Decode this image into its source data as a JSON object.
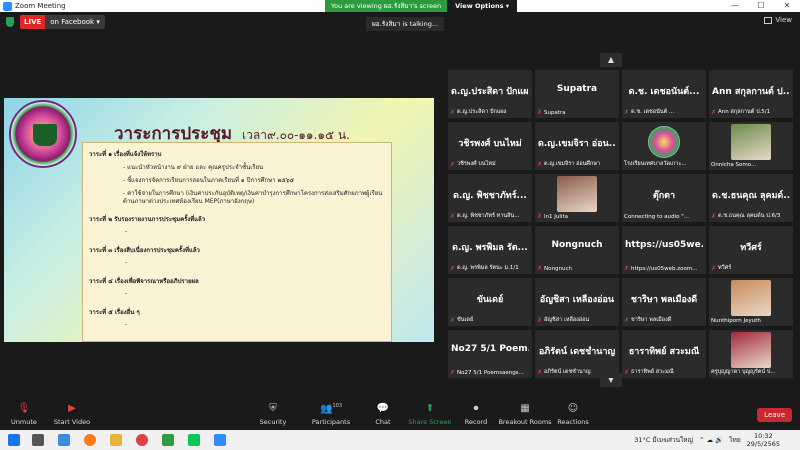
{
  "window": {
    "title": "Zoom Meeting",
    "minimize": "—",
    "maximize": "☐",
    "close": "✕"
  },
  "banner": {
    "viewing": "You are viewing ผอ.รังสิมา's screen",
    "view_options": "View Options ▾"
  },
  "topbar": {
    "live_tag": "LIVE",
    "live_target": "on Facebook ▾",
    "view_label": "View"
  },
  "talking": "ผอ.รังสิมา is talking...",
  "pager": {
    "up": "▲",
    "down": "▼"
  },
  "slide": {
    "headline": "วาระการประชุม",
    "time": "เวลา๙.๐๐-๑๑.๑๕ น.",
    "agenda": [
      {
        "title": "วาระที่ ๑ เรื่องที่แจ้งให้ทราบ",
        "items": [
          "- แนะนำหัวหน้างาน ๙ ฝ่าย และ คุณครูประจำชั้นเรียน",
          "- ชี้แจงการจัดการเรียนการสอนในภาคเรียนที่ ๑ ปีการศึกษา ๒๕๖๕",
          "- ค่าใช้จ่ายในการศึกษา (เงินค่าประกันอุบัติเหตุ/เงินค่าบำรุงการศึกษาโครงการส่งเสริมศักยภาพผู้เรียน ด้านภาษาต่างประเทศห้องเรียน MEP(ภาษาอังกฤษ)"
        ]
      },
      {
        "title": "วาระที่ ๒ รับรองรายงานการประชุมครั้งที่แล้ว",
        "items": [
          "-"
        ]
      },
      {
        "title": "วาระที่ ๓ เรื่องสืบเนื่องการประชุมครั้งที่แล้ว",
        "items": [
          "-"
        ]
      },
      {
        "title": "วาระที่ ๔ เรื่องเพื่อพิจารณาหรืออภิปรายผล",
        "items": [
          "-"
        ]
      },
      {
        "title": "วาระที่ ๕ เรื่องอื่น ๆ",
        "items": [
          "-"
        ]
      }
    ]
  },
  "participants": [
    {
      "big": "ด.ญ.ประสิดา ปักแผ...",
      "foot": "ด.ญ.ประสิดา ปักแผง",
      "muted": true,
      "photo": ""
    },
    {
      "big": "Supatra",
      "foot": "Supatra",
      "muted": true,
      "photo": ""
    },
    {
      "big": "ด.ช. เดชอนันต์...",
      "foot": "ด.ช. เดชอนันต์ ...",
      "muted": true,
      "photo": ""
    },
    {
      "big": "Ann สกุลกานต์ ป...",
      "foot": "Ann สกุลกานต์ ป.5/1",
      "muted": true,
      "photo": ""
    },
    {
      "big": "วชิรพงศ์ บนไหม่",
      "foot": "วชิรพงศ์ บนไหม่",
      "muted": true,
      "photo": ""
    },
    {
      "big": "ด.ญ.เขมจิรา อ่อน...",
      "foot": "ด.ญ.เขมจิรา อ่อนศึกษา",
      "muted": true,
      "photo": ""
    },
    {
      "big": "",
      "foot": "โรงเรียนเทศบาลวัดเกาะ...",
      "muted": false,
      "photo": "logo"
    },
    {
      "big": "",
      "foot": "Onnicha Somo...",
      "muted": false,
      "photo": "#6d8a4a"
    },
    {
      "big": "ด.ญ. พิชชาภัทร์...",
      "foot": "ด.ญ. พิชชาภัทร์ ทานสิน...",
      "muted": true,
      "photo": ""
    },
    {
      "big": "",
      "foot": "ln1 Julita",
      "muted": true,
      "photo": "#8a5a4a"
    },
    {
      "big": "ตุ๊กตา",
      "foot": "Connecting to audio \"...",
      "muted": false,
      "photo": ""
    },
    {
      "big": "ด.ช.ธนคุณ ลุคมด์...",
      "foot": "ด.ช.ธนคุณ ลุคมด์น ป.6/3",
      "muted": true,
      "photo": ""
    },
    {
      "big": "ด.ญ. พรพิมล รัต...",
      "foot": "ด.ญ. พรพิมล รัตนะ ม.1/1",
      "muted": true,
      "photo": ""
    },
    {
      "big": "Nongnuch",
      "foot": "Nongnuch",
      "muted": true,
      "photo": ""
    },
    {
      "big": "https://us05we...",
      "foot": "https://us05web.zoom...",
      "muted": true,
      "photo": ""
    },
    {
      "big": "ทวีศร์",
      "foot": "ทวีศร์",
      "muted": true,
      "photo": ""
    },
    {
      "big": "ขันเดย์",
      "foot": "ขันเดย์",
      "muted": true,
      "photo": ""
    },
    {
      "big": "อัญชิสา เหลืองอ่อน",
      "foot": "อัญชิสา เหลืองอ่อน",
      "muted": true,
      "photo": ""
    },
    {
      "big": "ชาริษา พลเมืองดี",
      "foot": "ชาริษา พลเมืองดี",
      "muted": true,
      "photo": ""
    },
    {
      "big": "",
      "foot": "Nunthiporn Jeyuth",
      "muted": false,
      "photo": "#c98a5a"
    },
    {
      "big": "No27 5/1 Poem...",
      "foot": "No27 5/1 Poemsaengs...",
      "muted": true,
      "photo": ""
    },
    {
      "big": "อภิรัตน์ เดชชำนาญ",
      "foot": "อภิรัตน์ เดชชำนาญ",
      "muted": true,
      "photo": ""
    },
    {
      "big": "ธาราทิพย์ สวะมณี",
      "foot": "ธาราทิพย์ สวะมณี",
      "muted": true,
      "photo": ""
    },
    {
      "big": "",
      "foot": "ครูบุญญาดา บุญญรัตน์ ป...",
      "muted": false,
      "photo": "#a22a3a"
    }
  ],
  "toolbar": {
    "unmute": "Unmute",
    "start_video": "Start Video",
    "security": "Security",
    "participants": "Participants",
    "participants_count": "103",
    "chat": "Chat",
    "share": "Share Screen",
    "record": "Record",
    "breakout": "Breakout Rooms",
    "reactions": "Reactions",
    "leave": "Leave"
  },
  "taskbar": {
    "weather": "31°C มีเมฆส่วนใหญ่",
    "language": "ไทย",
    "time": "10:32",
    "date": "29/5/2565"
  },
  "colors": {
    "accent": "#2d8cff",
    "live": "#e02828",
    "leave": "#c9282d",
    "share": "#23a455"
  }
}
